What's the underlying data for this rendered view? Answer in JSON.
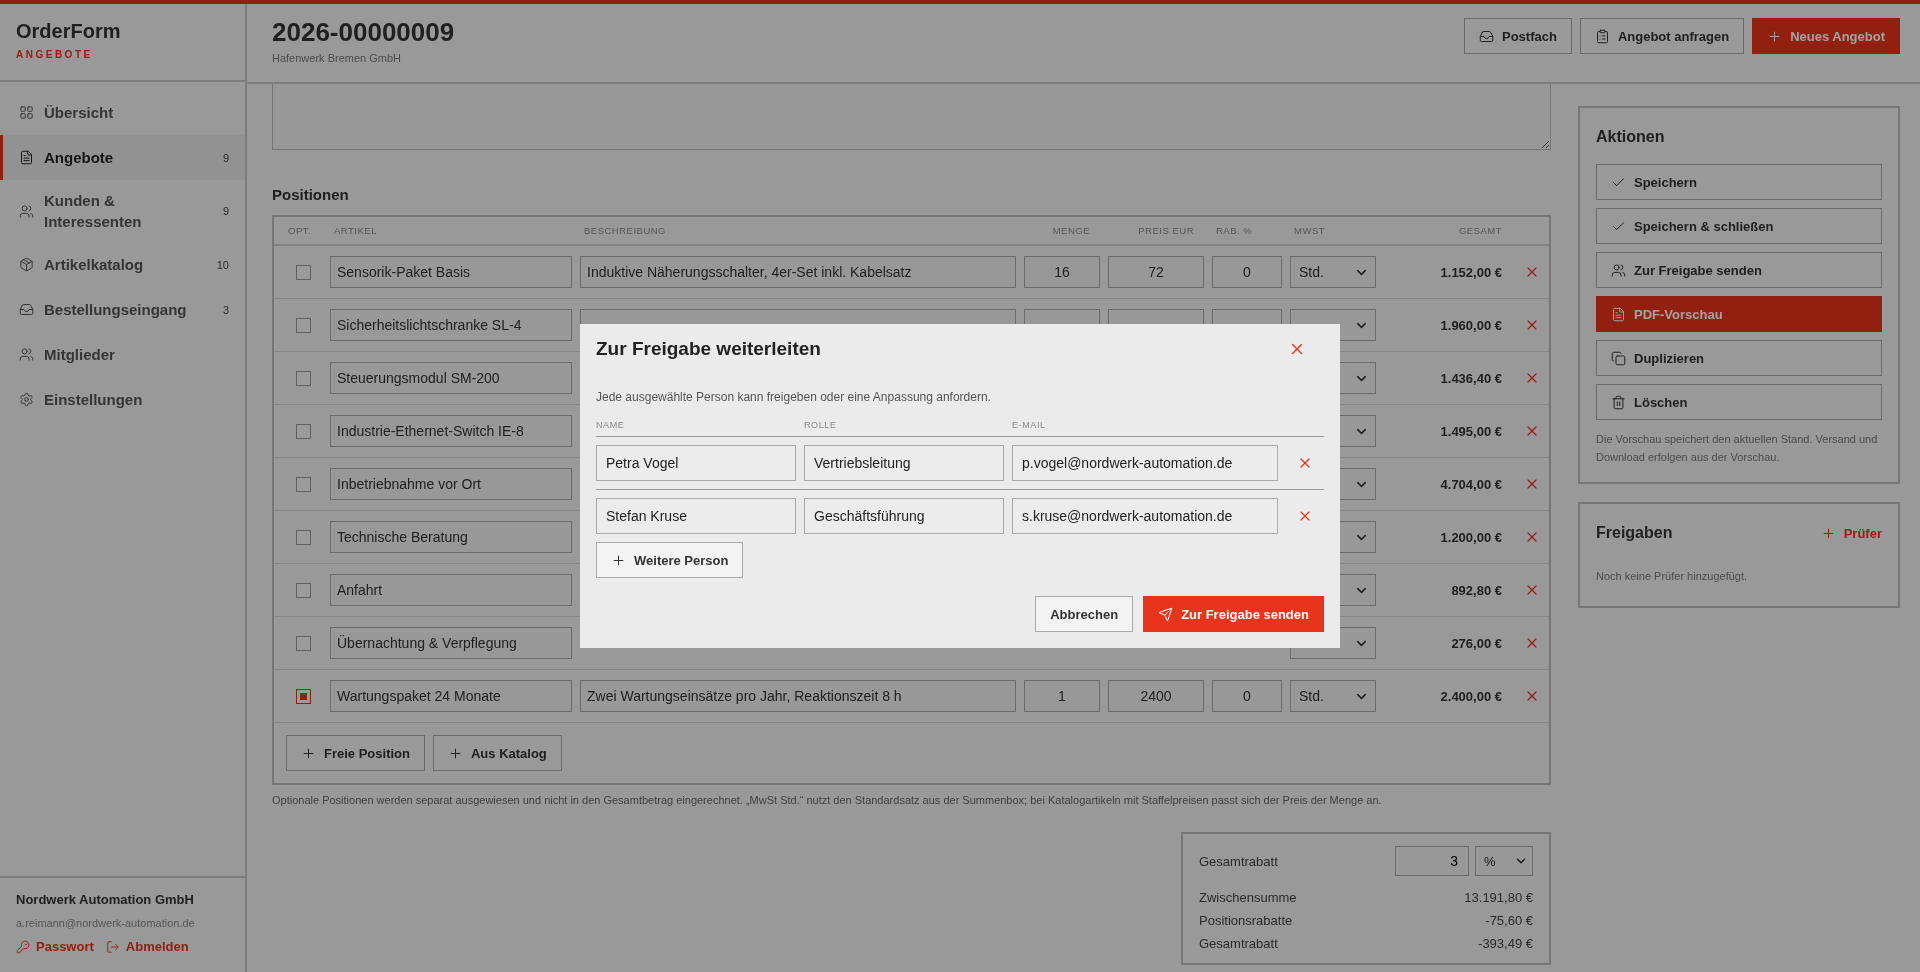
{
  "app": {
    "name": "OrderForm",
    "section": "ANGEBOTE"
  },
  "nav": [
    {
      "label": "Übersicht",
      "selected": false
    },
    {
      "label": "Angebote",
      "count": "9",
      "selected": true
    },
    {
      "label": "Kunden & Interessenten",
      "count": "9",
      "selected": false
    },
    {
      "label": "Artikelkatalog",
      "count": "10",
      "selected": false
    },
    {
      "label": "Bestellungseingang",
      "count": "3",
      "selected": false
    },
    {
      "label": "Mitglieder",
      "selected": false
    },
    {
      "label": "Einstellungen",
      "selected": false
    }
  ],
  "account": {
    "company": "Nordwerk Automation GmbH",
    "email": "a.reimann@nordwerk-automation.de",
    "links": [
      "Passwort",
      "Abmelden"
    ]
  },
  "header": {
    "title": "2026-00000009",
    "subtitle": "Hafenwerk Bremen GmbH",
    "buttons": [
      {
        "label": "Postfach",
        "kind": "outline"
      },
      {
        "label": "Angebot anfragen",
        "kind": "outline"
      },
      {
        "label": "Neues Angebot",
        "kind": "primary"
      }
    ]
  },
  "positions": {
    "title": "Positionen",
    "columns": [
      "OPT.",
      "ARTIKEL",
      "BESCHREIBUNG",
      "MENGE",
      "PREIS EUR",
      "RAB. %",
      "MWST",
      "GESAMT"
    ],
    "rows": [
      {
        "kind": "full",
        "optional": false,
        "article": "Sensorik-Paket Basis",
        "description": "Induktive Näherungsschalter, 4er-Set inkl. Kabelsatz",
        "qty": "16",
        "price": "72",
        "discount": "0",
        "vat": "Std.",
        "total": "1.152,00 €"
      },
      {
        "kind": "full",
        "optional": false,
        "article": "Sicherheitslichtschranke SL-4",
        "total": "1.960,00 €"
      },
      {
        "kind": "covered",
        "optional": false,
        "article": "Steuerungsmodul SM-200",
        "total": "1.436,40 €"
      },
      {
        "kind": "covered",
        "optional": false,
        "article": "Industrie-Ethernet-Switch IE-8",
        "total": "1.495,00 €"
      },
      {
        "kind": "covered",
        "optional": false,
        "article": "Inbetriebnahme vor Ort",
        "total": "4.704,00 €"
      },
      {
        "kind": "covered",
        "optional": false,
        "article": "Technische Beratung",
        "total": "1.200,00 €"
      },
      {
        "kind": "covered",
        "optional": false,
        "article": "Anfahrt",
        "total": "892,80 €"
      },
      {
        "kind": "covered",
        "optional": false,
        "article": "Übernachtung & Verpflegung",
        "total": "276,00 €"
      },
      {
        "kind": "full",
        "optional": true,
        "article": "Wartungspaket 24 Monate",
        "description": "Zwei Wartungseinsätze pro Jahr, Reaktionszeit 8 h",
        "qty": "1",
        "price": "2400",
        "discount": "0",
        "vat": "Std.",
        "total": "2.400,00 €"
      }
    ],
    "add_buttons": [
      "Freie Position",
      "Aus Katalog"
    ],
    "note": "Optionale Positionen werden separat ausgewiesen und nicht in den Gesamtbetrag eingerechnet. „MwSt Std.“ nutzt den Standardsatz aus der Summenbox; bei Katalogartikeln mit Staffelpreisen passt sich der Preis der Menge an."
  },
  "summary": {
    "discount_label": "Gesamtrabatt",
    "discount_value": "3",
    "discount_unit": "%",
    "lines": [
      {
        "label": "Zwischensumme",
        "value": "13.191,80 €"
      },
      {
        "label": "Positionsrabatte",
        "value": "-75,60 €"
      },
      {
        "label": "Gesamtrabatt",
        "value": "-393,49 €"
      }
    ]
  },
  "actions": {
    "title": "Aktionen",
    "buttons": [
      {
        "label": "Speichern",
        "kind": "outline"
      },
      {
        "label": "Speichern & schließen",
        "kind": "outline"
      },
      {
        "label": "Zur Freigabe senden",
        "kind": "outline"
      },
      {
        "label": "PDF-Vorschau",
        "kind": "primary"
      },
      {
        "label": "Duplizieren",
        "kind": "outline"
      },
      {
        "label": "Löschen",
        "kind": "outline"
      }
    ],
    "note": "Die Vorschau speichert den aktuellen Stand. Versand und Download erfolgen aus der Vorschau."
  },
  "approvals": {
    "title": "Freigaben",
    "add_label": "Prüfer",
    "empty": "Noch keine Prüfer hinzugefügt."
  },
  "dialog": {
    "title": "Zur Freigabe weiterleiten",
    "text": "Jede ausgewählte Person kann freigeben oder eine Anpassung anfordern.",
    "columns": [
      "NAME",
      "ROLLE",
      "E-MAIL"
    ],
    "people": [
      {
        "name": "Petra Vogel",
        "role": "Vertriebsleitung",
        "email": "p.vogel@nordwerk-automation.de"
      },
      {
        "name": "Stefan Kruse",
        "role": "Geschäftsführung",
        "email": "s.kruse@nordwerk-automation.de"
      }
    ],
    "add_label": "Weitere Person",
    "buttons": [
      {
        "label": "Abbrechen",
        "kind": "outline"
      },
      {
        "label": "Zur Freigabe senden",
        "kind": "primary"
      }
    ]
  }
}
